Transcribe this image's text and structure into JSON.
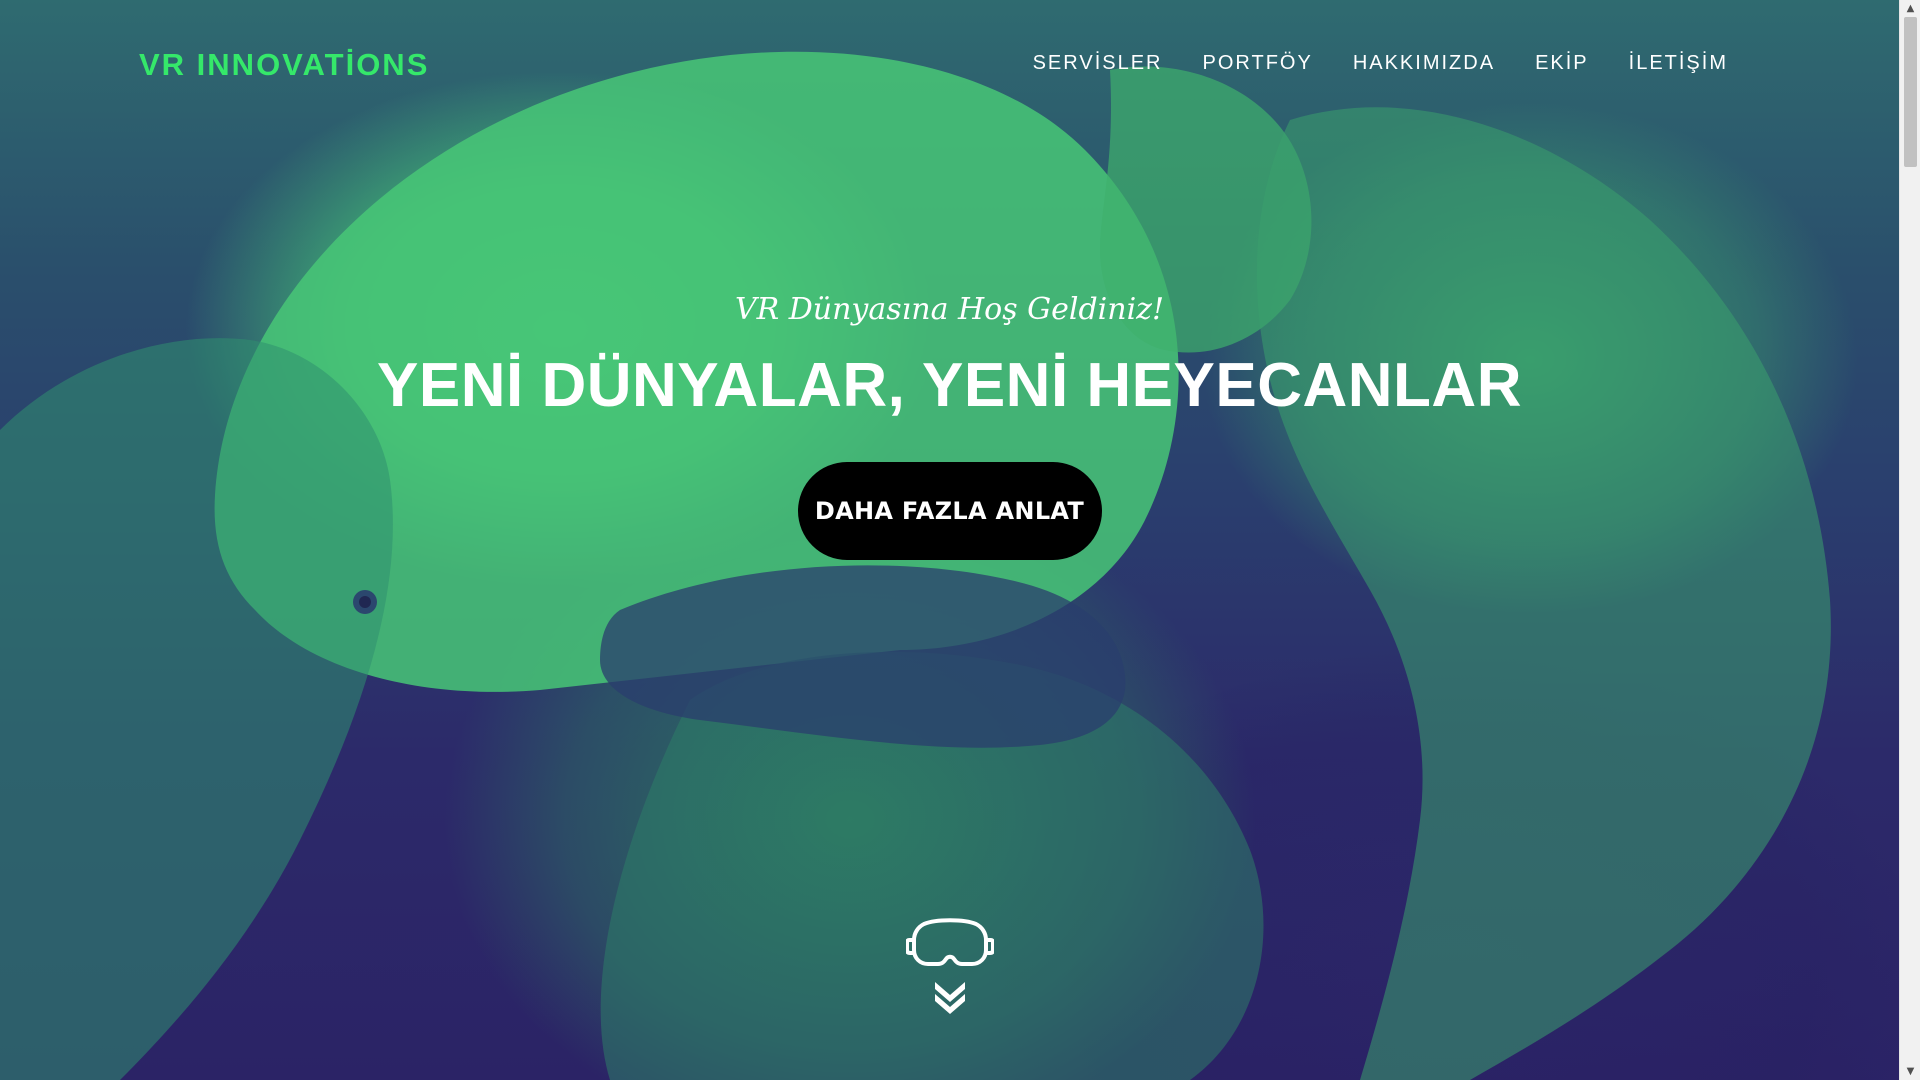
{
  "brand": {
    "name": "VR INNOVATİONS",
    "color": "#35e86a"
  },
  "nav": {
    "items": [
      {
        "label": "SERVİSLER"
      },
      {
        "label": "PORTFÖY"
      },
      {
        "label": "HAKKIMIZDA"
      },
      {
        "label": "EKİP"
      },
      {
        "label": "İLETİŞİM"
      }
    ]
  },
  "hero": {
    "subtitle": "VR Dünyasına Hoş Geldiniz!",
    "title": "YENİ DÜNYALAR, YENİ HEYECANLAR",
    "cta_label": "DAHA FAZLA ANLAT"
  },
  "icons": {
    "vr_headset": "vr-headset-icon",
    "double_chevron": "double-chevron-down-icon",
    "scroll_up": "scroll-up-arrow-icon",
    "scroll_down": "scroll-down-arrow-icon"
  },
  "colors": {
    "accent_green": "#35e86a",
    "overlay_top": "#2f6b70",
    "overlay_bottom": "#2b2366",
    "cta_bg": "#000000"
  }
}
